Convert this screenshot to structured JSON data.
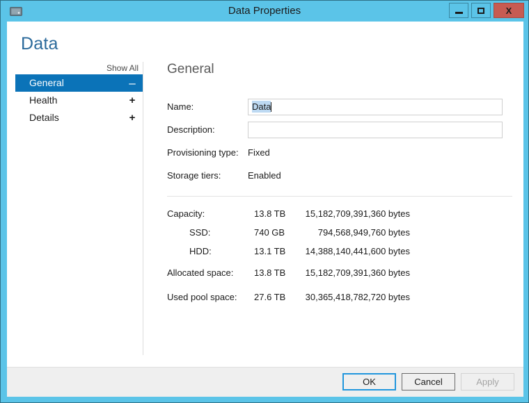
{
  "window": {
    "title": "Data Properties",
    "icon": "disk-drive-icon",
    "accent_color": "#5bc4e8",
    "selection_color": "#0b73b8",
    "controls": {
      "minimize": "minimize-icon",
      "maximize": "maximize-icon",
      "close_label": "X"
    }
  },
  "page": {
    "heading": "Data"
  },
  "nav": {
    "show_all": "Show All",
    "items": [
      {
        "label": "General",
        "sign": "–",
        "selected": true
      },
      {
        "label": "Health",
        "sign": "+",
        "selected": false
      },
      {
        "label": "Details",
        "sign": "+",
        "selected": false
      }
    ]
  },
  "content": {
    "title": "General",
    "fields": [
      {
        "label": "Name:",
        "value": "Data",
        "type": "textbox",
        "selected": true
      },
      {
        "label": "Description:",
        "value": "",
        "type": "textbox",
        "selected": false
      },
      {
        "label": "Provisioning type:",
        "value": "Fixed",
        "type": "static"
      },
      {
        "label": "Storage tiers:",
        "value": "Enabled",
        "type": "static"
      }
    ],
    "capacity_rows": [
      {
        "label": "Capacity:",
        "size": "13.8 TB",
        "bytes": "15,182,709,391,360 bytes",
        "indent": false,
        "gap_before": false
      },
      {
        "label": "SSD:",
        "size": "740 GB",
        "bytes": "794,568,949,760 bytes",
        "indent": true,
        "gap_before": false
      },
      {
        "label": "HDD:",
        "size": "13.1 TB",
        "bytes": "14,388,140,441,600 bytes",
        "indent": true,
        "gap_before": false
      },
      {
        "label": "Allocated space:",
        "size": "13.8 TB",
        "bytes": "15,182,709,391,360 bytes",
        "indent": false,
        "gap_before": true
      },
      {
        "label": "Used pool space:",
        "size": "27.6 TB",
        "bytes": "30,365,418,782,720 bytes",
        "indent": false,
        "gap_before": true
      }
    ]
  },
  "footer": {
    "ok": "OK",
    "cancel": "Cancel",
    "apply": "Apply"
  }
}
